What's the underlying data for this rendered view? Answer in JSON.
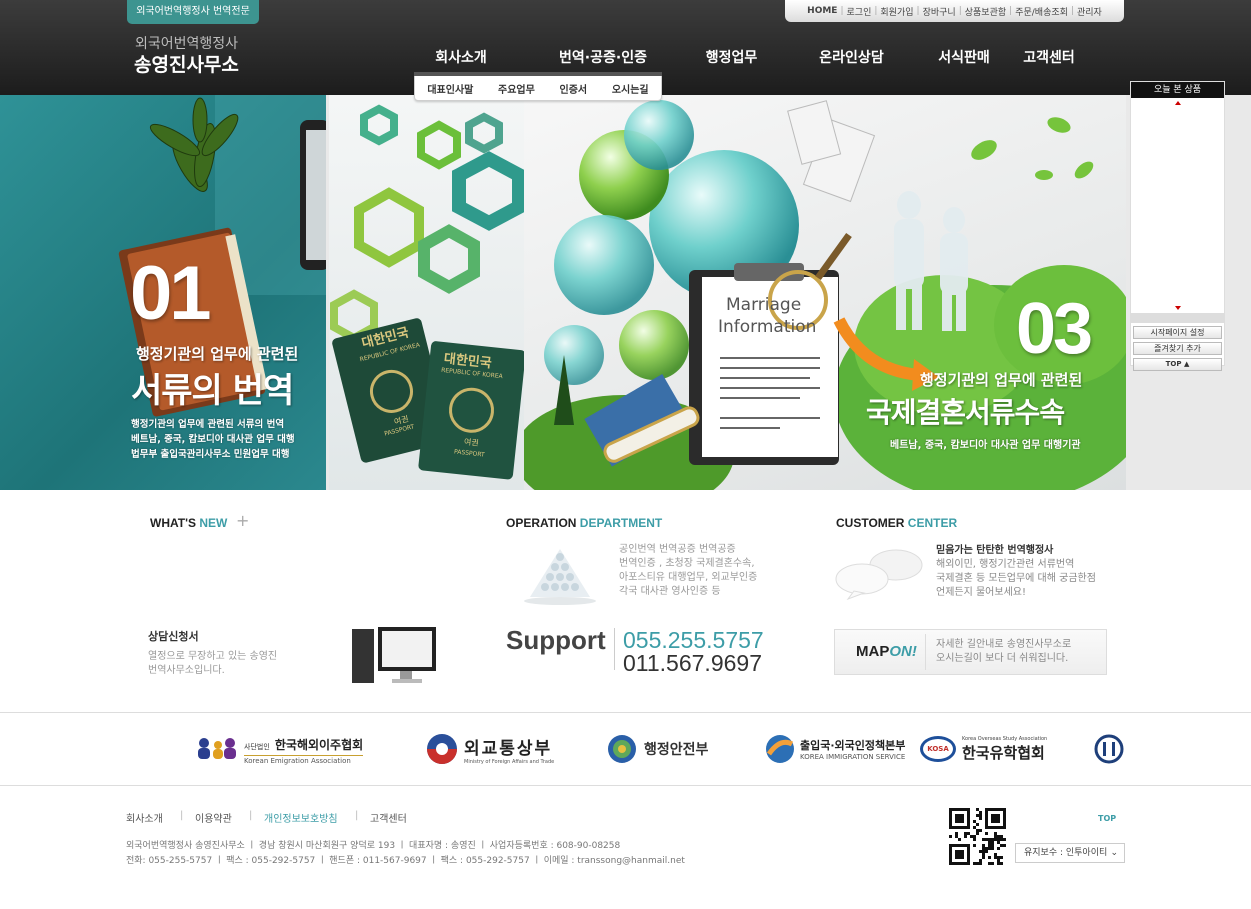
{
  "header": {
    "badge": "외국어번역행정사 번역전문",
    "logo_sub": "외국어번역행정사",
    "logo_main": "송영진사무소",
    "util_links": [
      "HOME",
      "로그인",
      "회원가입",
      "장바구니",
      "상품보관함",
      "주문/배송조회",
      "관리자"
    ],
    "gnb": [
      "회사소개",
      "번역·공증·인증",
      "행정업무",
      "온라인상담",
      "서식판매",
      "고객센터"
    ],
    "subnav": [
      "대표인사말",
      "주요업무",
      "인증서",
      "오시는길"
    ]
  },
  "banner": {
    "panel1": {
      "num": "01",
      "line1": "행정기관의 업무에 관련된",
      "line2": "서류의 번역",
      "desc": [
        "행정기관의 업무에 관련된 서류의 번역",
        "베트남, 중국, 캄보디아 대사관 업무 대행",
        "법무부 출입국관리사무소 민원업무 대행"
      ]
    },
    "panel2": {
      "passport_title": "대한민국",
      "passport_sub": "REPUBLIC OF KOREA",
      "passport_label": "여권",
      "passport_en": "PASSPORT"
    },
    "panel3": {
      "card_line1": "Marriage",
      "card_line2": "Information",
      "num": "03",
      "line1": "행정기관의 업무에 관련된",
      "line2": "국제결혼서류수속",
      "desc": "베트남, 중국, 캄보디아 대사관 업무 대행기관"
    }
  },
  "quick": {
    "title": "오늘 본 상품",
    "buttons": [
      "시작페이지 설정",
      "즐겨찾기 추가",
      "TOP ▲"
    ]
  },
  "whats_new": {
    "head_a": "WHAT'S",
    "head_b": "NEW",
    "plus": "+"
  },
  "operation": {
    "head_a": "OPERATION",
    "head_b": "DEPARTMENT",
    "lines": [
      "공인번역 번역공증 번역공증",
      "번역인증 , 초청장 국제결혼수속,",
      "아포스티유 대행업무, 외교부인증",
      "각국 대사관 영사인증 등"
    ]
  },
  "customer": {
    "head_a": "CUSTOMER",
    "head_b": "CENTER",
    "title": "믿음가는 탄탄한 번역행정사",
    "lines": [
      "해외이민, 행정기간관련 서류번역",
      "국제결혼 등 모든업무에 대해 궁금한점",
      "언제든지 물어보세요!"
    ]
  },
  "consult": {
    "title": "상담신청서",
    "lines": [
      "열정으로 무장하고 있는 송영진",
      "번역사무소입니다."
    ]
  },
  "support": {
    "label": "Support",
    "phone1": "055.255.5757",
    "phone2": "011.567.9697"
  },
  "mapon": {
    "map": "MAP",
    "on": "ON!",
    "lines": [
      "자세한 길안내로 송영진사무소로",
      "오시는길이 보다 더 쉬워집니다."
    ]
  },
  "logos": {
    "emigration_small": "사단법인",
    "emigration": "한국해외이주협회",
    "emigration_en": "Korean Emigration Association",
    "mofat": "외교통상부",
    "mofat_en": "Ministry of Foreign Affairs and Trade",
    "mopas": "행정안전부",
    "immigration": "출입국·외국인정책본부",
    "immigration_en": "KOREA IMMIGRATION SERVICE",
    "kosa_small": "Korea Overseas Study Association",
    "kosa": "한국유학협회",
    "kosa_badge": "KOSA"
  },
  "footer": {
    "nav": [
      "회사소개",
      "이용약관",
      "개인정보보호방침",
      "고객센터"
    ],
    "info1": "외국어번역행정사 송영진사무소  ㅣ  경남 창원시 마산회원구 양덕로 193  ㅣ  대표자명 : 송영진  ㅣ  사업자등록번호 :  608-90-08258",
    "info2": "전화: 055-255-5757  ㅣ  팩스 : 055-292-5757  ㅣ  핸드폰 : 011-567-9697  ㅣ  팩스 : 055-292-5757  ㅣ  이메일 : transsong@hanmail.net",
    "top": "TOP",
    "maintenance": "유지보수 : 인투아이티"
  },
  "colors": {
    "accent": "#3d9da7",
    "badge": "#3d9490",
    "header_bg": "#2a2a2a",
    "orange": "#f28c1e",
    "green": "#66b52c"
  }
}
